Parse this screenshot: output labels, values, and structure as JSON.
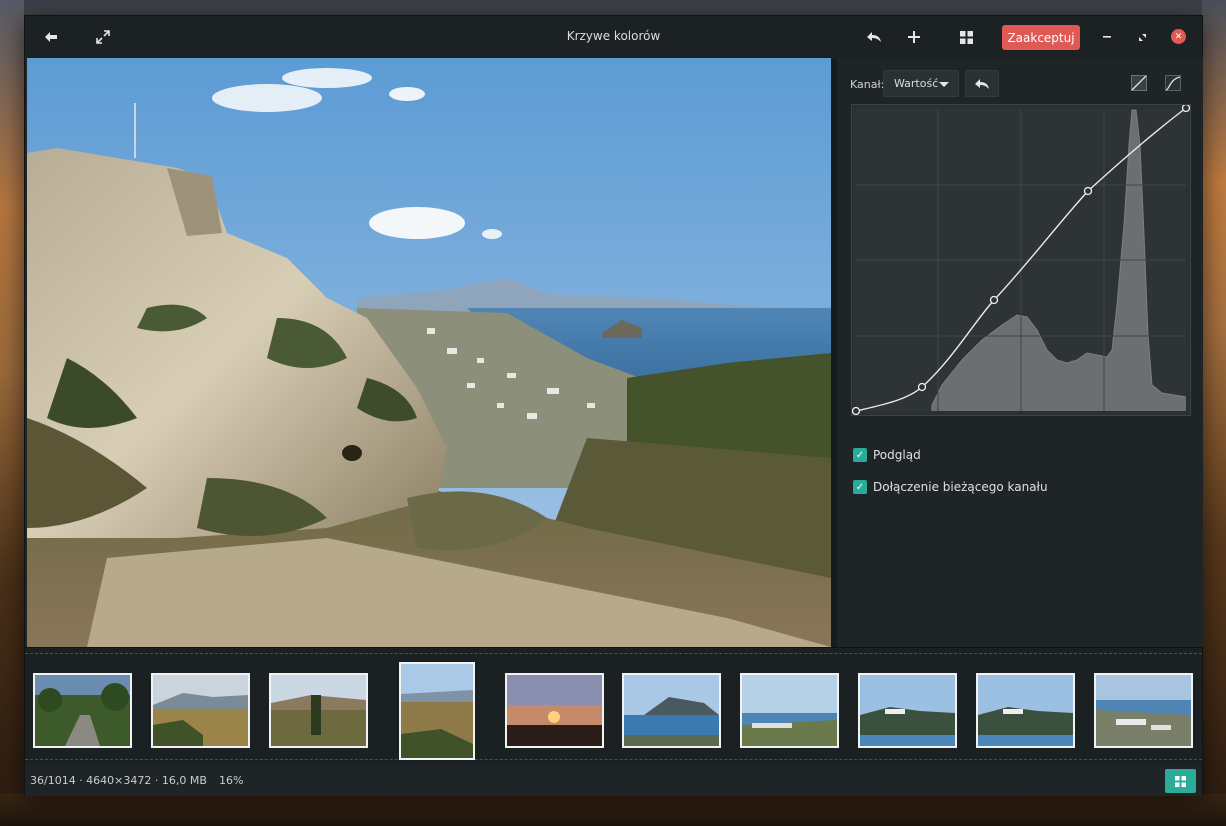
{
  "window": {
    "title": "Krzywe kolorów"
  },
  "toolbar": {
    "accept_label": "Zaakceptuj",
    "close_glyph": "✕"
  },
  "panel": {
    "channel_label": "Kanał:",
    "channel_value": "Wartość",
    "preview_label": "Podgląd",
    "join_channel_label": "Dołączenie bieżącego kanału"
  },
  "status": {
    "info": "36/1014  ·  4640×3472  ·  16,0 MB",
    "zoom": "16%"
  },
  "colors": {
    "accent": "#2bac98",
    "accept": "#e05a55"
  },
  "icons": {
    "back": "back-arrow-icon",
    "fullscreen": "fullscreen-icon",
    "undo": "undo-icon",
    "add": "plus-icon",
    "grid": "grid-icon",
    "minimize": "minimize-icon",
    "restore": "restore-icon",
    "close": "close-icon"
  },
  "filmstrip": {
    "count": 10,
    "selected_index": 3
  }
}
